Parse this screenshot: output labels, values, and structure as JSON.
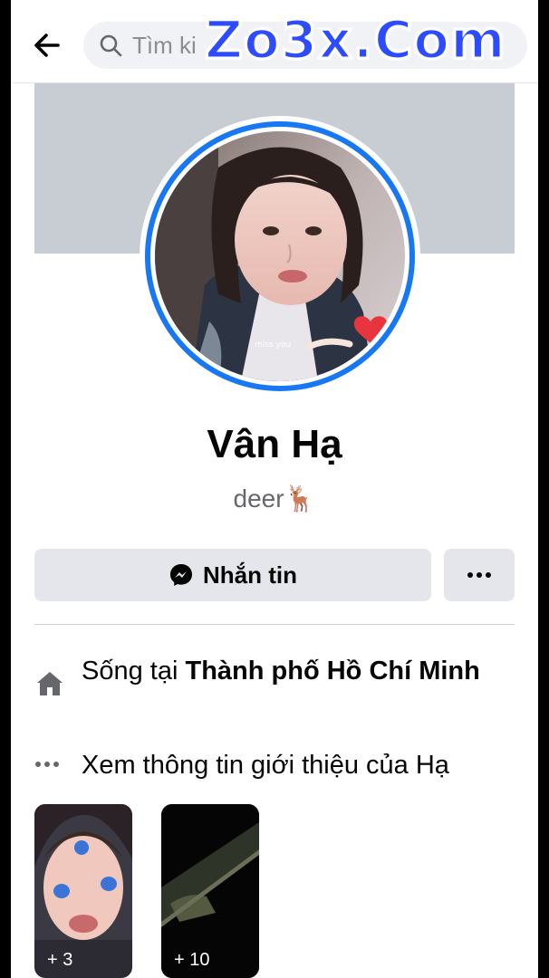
{
  "search": {
    "placeholder": "Tìm ki"
  },
  "watermark": "Zo3x.Com",
  "profile": {
    "name": "Vân Hạ",
    "bio_text": "deer",
    "bio_emoji": "🦌",
    "avatar_caption": "miss you"
  },
  "actions": {
    "message_label": "Nhắn tin"
  },
  "intro": {
    "lives_prefix": "Sống tại ",
    "lives_city": "Thành phố Hồ Chí Minh",
    "about_label": "Xem thông tin giới thiệu của Hạ"
  },
  "stories": [
    {
      "count": "+ 3"
    },
    {
      "count": "+ 10"
    }
  ],
  "colors": {
    "accent": "#1877f2",
    "button_bg": "#e4e6eb",
    "watermark": "#2d4cff"
  },
  "icons": [
    "back-arrow-icon",
    "search-icon",
    "messenger-icon",
    "more-dots-icon",
    "home-icon",
    "more-horizontal-icon",
    "heart-icon"
  ]
}
